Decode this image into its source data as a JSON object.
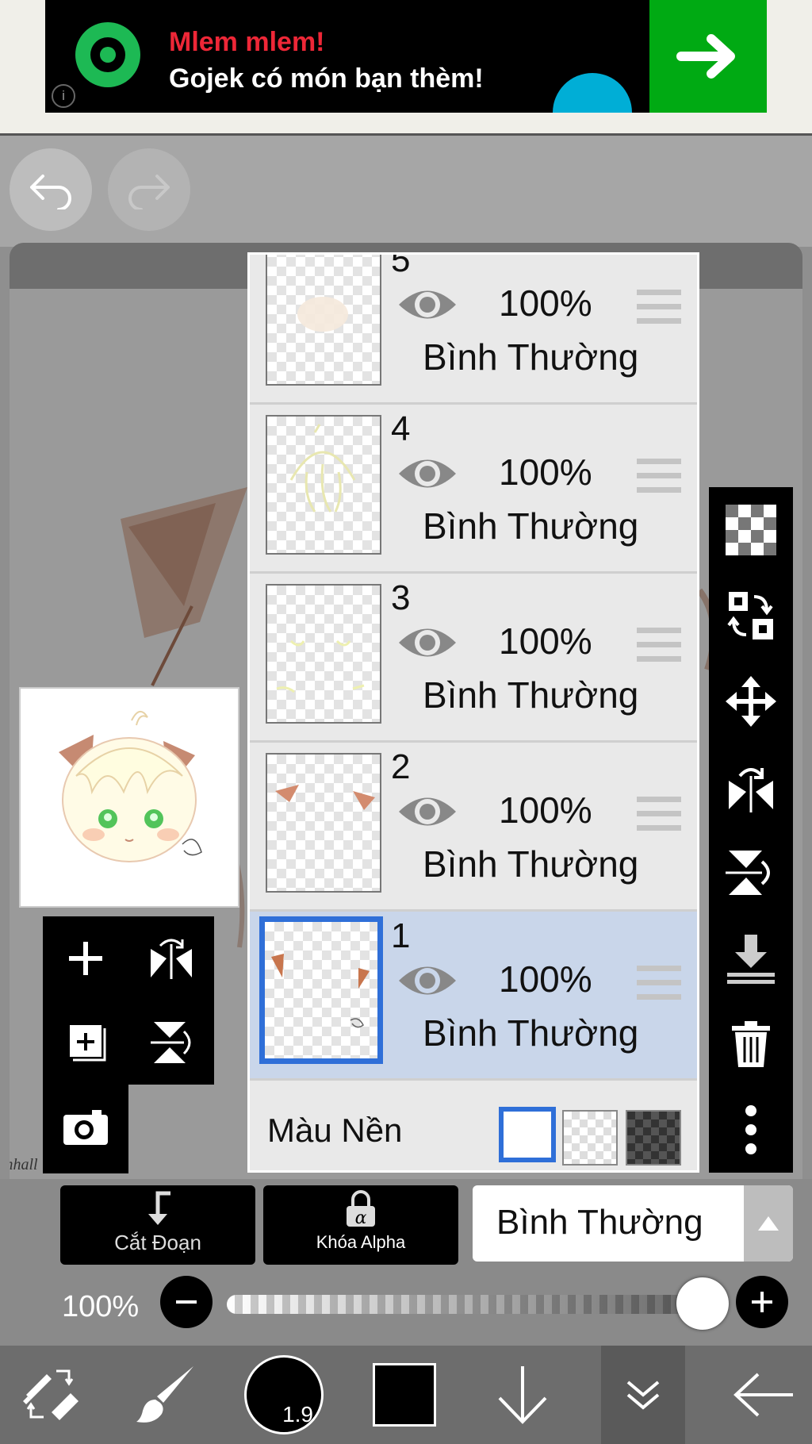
{
  "ad": {
    "headline": "Mlem mlem!",
    "subline": "Gojek có món bạn thèm!",
    "cta_icon": "arrow-right-icon",
    "info_icon": "info-icon",
    "colors": {
      "headline": "#ee2737",
      "cta": "#00aa13"
    }
  },
  "top_bar": {
    "undo_icon": "undo-icon",
    "redo_icon": "redo-icon"
  },
  "layers": [
    {
      "number": "5",
      "opacity": "100%",
      "blend": "Bình Thường",
      "selected": false
    },
    {
      "number": "4",
      "opacity": "100%",
      "blend": "Bình Thường",
      "selected": false
    },
    {
      "number": "3",
      "opacity": "100%",
      "blend": "Bình Thường",
      "selected": false
    },
    {
      "number": "2",
      "opacity": "100%",
      "blend": "Bình Thường",
      "selected": false
    },
    {
      "number": "1",
      "opacity": "100%",
      "blend": "Bình Thường",
      "selected": true
    }
  ],
  "background": {
    "label": "Màu Nền",
    "options": [
      "white",
      "transparent",
      "dark-checker"
    ],
    "selected": "white"
  },
  "controls": {
    "clipping_label": "Cắt Đoạn",
    "alpha_lock_label": "Khóa Alpha",
    "blend_mode": "Bình Thường",
    "opacity_label": "100%",
    "opacity_value": 1.0
  },
  "bottom_toolbar": {
    "brush_size": "1.9",
    "primary_color": "#000000"
  },
  "accent_color": "#2f6fd8"
}
